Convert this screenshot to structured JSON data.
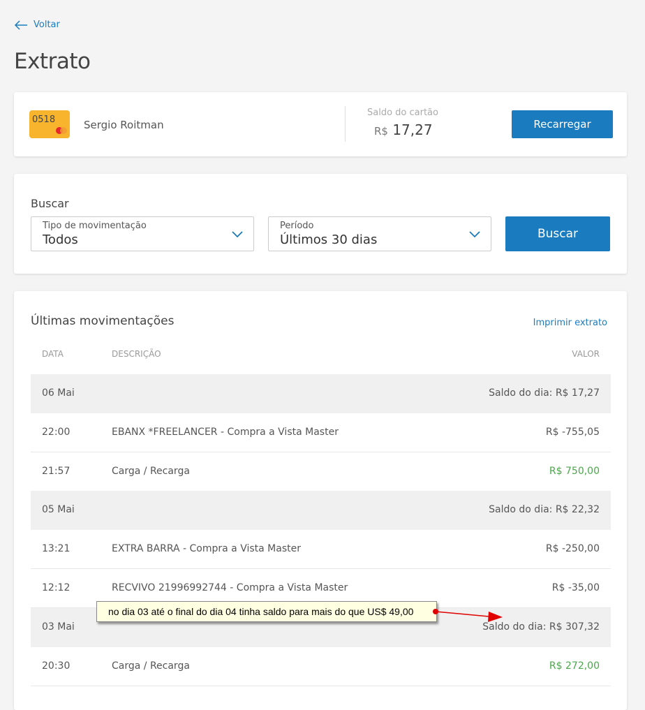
{
  "nav": {
    "back_label": "Voltar"
  },
  "page_title": "Extrato",
  "account": {
    "card_last_digits": "0518",
    "holder": "Sergio Roitman",
    "balance_label": "Saldo do cartão",
    "currency": "R$",
    "balance": "17,27",
    "recharge_label": "Recarregar"
  },
  "search": {
    "title": "Buscar",
    "type_label": "Tipo de movimentação",
    "type_value": "Todos",
    "period_label": "Período",
    "period_value": "Últimos 30 dias",
    "button_label": "Buscar"
  },
  "movements": {
    "title": "Últimas movimentações",
    "print_label": "Imprimir extrato",
    "columns": [
      "DATA",
      "DESCRIÇÃO",
      "VALOR"
    ],
    "rows": [
      {
        "kind": "day",
        "date": "06 Mai",
        "value": "Saldo do dia: R$ 17,27"
      },
      {
        "kind": "tx",
        "date": "22:00",
        "desc": "EBANX *FREELANCER - Compra a Vista Master",
        "value": "R$ -755,05"
      },
      {
        "kind": "tx",
        "date": "21:57",
        "desc": "Carga / Recarga",
        "value": "R$ 750,00",
        "positive": true
      },
      {
        "kind": "day",
        "date": "05 Mai",
        "value": "Saldo do dia: R$ 22,32"
      },
      {
        "kind": "tx",
        "date": "13:21",
        "desc": "EXTRA BARRA - Compra a Vista Master",
        "value": "R$ -250,00"
      },
      {
        "kind": "tx",
        "date": "12:12",
        "desc": "RECVIVO 21996992744 - Compra a Vista Master",
        "value": "R$ -35,00"
      },
      {
        "kind": "day",
        "date": "03 Mai",
        "value": "Saldo do dia: R$ 307,32"
      },
      {
        "kind": "tx",
        "date": "20:30",
        "desc": "Carga / Recarga",
        "value": "R$ 272,00",
        "positive": true
      }
    ]
  },
  "annotation": {
    "text": "no dia 03 até o final do dia 04 tinha saldo para mais do que US$ 49,00",
    "color": "#e00000"
  },
  "colors": {
    "accent": "#1a7cbf",
    "card": "#f7b42c",
    "positive": "#4ca64c"
  }
}
